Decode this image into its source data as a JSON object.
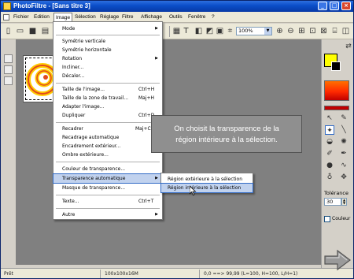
{
  "window": {
    "title": "PhotoFiltre - [Sans titre 3]"
  },
  "menubar": {
    "items": [
      "Fichier",
      "Edition",
      "Image",
      "Sélection",
      "Réglage",
      "Filtre",
      "Affichage",
      "Outils",
      "Fenêtre",
      "?"
    ],
    "active_index": 2
  },
  "toolbar": {
    "zoom_value": "100%",
    "text_tool_glyph": "T"
  },
  "image_menu": {
    "items": [
      {
        "label": "Mode",
        "submenu": true
      },
      {
        "label": "Symétrie verticale"
      },
      {
        "label": "Symétrie horizontale"
      },
      {
        "label": "Rotation",
        "submenu": true
      },
      {
        "label": "Incliner..."
      },
      {
        "label": "Décaler..."
      },
      {
        "label": "Taille de l'image...",
        "shortcut": "Ctrl+H"
      },
      {
        "label": "Taille de la zone de travail...",
        "shortcut": "Maj+H"
      },
      {
        "label": "Adapter l'image..."
      },
      {
        "label": "Dupliquer",
        "shortcut": "Ctrl+D"
      },
      {
        "label": "Recadrer",
        "shortcut": "Maj+Ctrl+H"
      },
      {
        "label": "Recadrage automatique"
      },
      {
        "label": "Encadrement extérieur..."
      },
      {
        "label": "Ombre extérieure..."
      },
      {
        "label": "Couleur de transparence..."
      },
      {
        "label": "Transparence automatique",
        "submenu": true,
        "highlighted": true
      },
      {
        "label": "Masque de transparence..."
      },
      {
        "label": "Texte...",
        "shortcut": "Ctrl+T"
      },
      {
        "label": "Autre",
        "submenu": true
      }
    ]
  },
  "submenu": {
    "items": [
      {
        "label": "Région extérieure à la sélection"
      },
      {
        "label": "Région intérieure à la sélection",
        "highlighted": true
      }
    ]
  },
  "callout": {
    "line1": "On choisit la transparence de la",
    "line2": "région intérieure à la sélection."
  },
  "right_panel": {
    "tolerance_label": "Tolérance",
    "tolerance_value": "30",
    "couleur_label": "Couleur",
    "foreground_color": "#ffff00",
    "background_color": "#000000"
  },
  "statusbar": {
    "status": "Prêt",
    "image_info": "100x100x16M",
    "pixel_info": "0,0 ==> 99,99 (L=100, H=100, L/H=1)"
  },
  "colors": {
    "title_bar": "#0a4dc8",
    "menu_highlight": "#c1d2ee",
    "callout_bg": "#8f8f8f"
  }
}
